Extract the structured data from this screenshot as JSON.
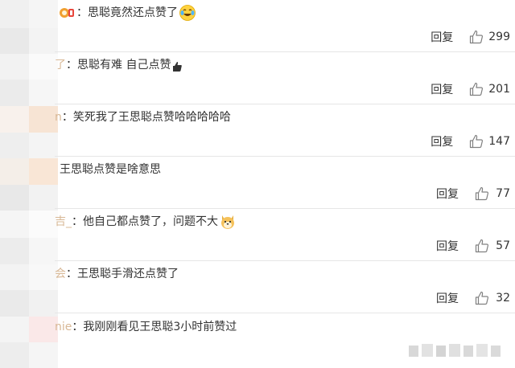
{
  "comments": [
    {
      "user": "",
      "text": "思聪竟然还点赞了",
      "reply_label": "回复",
      "likes": "299",
      "emoji": "laughing-tears-emoji",
      "badge": "vip-badge-icon"
    },
    {
      "user": "了",
      "text": "思聪有难  自己点赞",
      "reply_label": "回复",
      "likes": "201",
      "emoji": "thumbs-icon"
    },
    {
      "user": "n",
      "text": "笑死我了王思聪点赞哈哈哈哈哈",
      "reply_label": "回复",
      "likes": "147"
    },
    {
      "user": "",
      "text": "王思聪点赞是啥意思",
      "reply_label": "回复",
      "likes": "77"
    },
    {
      "user": "吉_",
      "text": "他自己都点赞了，问题不大",
      "reply_label": "回复",
      "likes": "57",
      "emoji": "doge-emoji"
    },
    {
      "user": "会",
      "text": "王思聪手滑还点赞了",
      "reply_label": "回复",
      "likes": "32"
    },
    {
      "user": "nie",
      "text": "我刚刚看见王思聪3小时前赞过",
      "reply_label": "",
      "likes": ""
    }
  ],
  "colors": {
    "text": "#333333",
    "username": "#c8a07a",
    "divider": "#e6e6e6",
    "icon": "#808080"
  }
}
